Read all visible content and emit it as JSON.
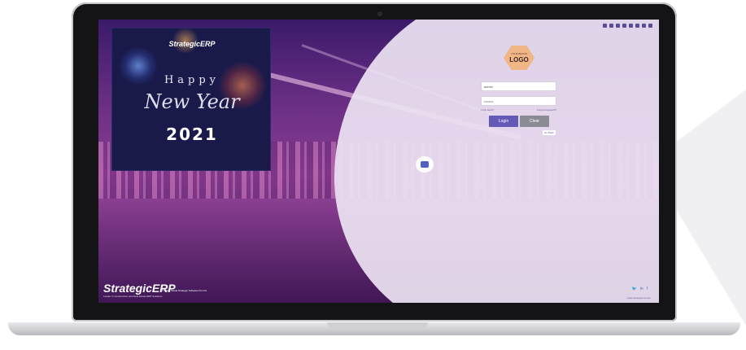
{
  "promo": {
    "brand": "StrategicERP",
    "happy": "Happy",
    "new_year": "New Year",
    "year": "2021"
  },
  "login": {
    "logo_small": "YOUR BRAND",
    "logo_text": "LOGO",
    "username_value": "admin",
    "password_value": "••••••••",
    "link_left": "Login Here?",
    "link_right": "Forgot password?",
    "login_label": "Login",
    "clear_label": "Clear",
    "small_link": "Go Back"
  },
  "footer": {
    "brand": "StrategicERP",
    "tagline": "Leader in Construction and Real Estate ERP Solutions",
    "copyright": "© 2021 Tiavak Strategic Software Pvt Ltd",
    "website": "www.strategicerp.com"
  },
  "icons": [
    "mail-icon",
    "facebook-icon",
    "user-icon",
    "globe-icon",
    "gear-icon",
    "calendar-icon",
    "chat-icon",
    "home-icon"
  ],
  "colors": {
    "login_button": "#6559b8",
    "clear_button": "#8b8b94",
    "logo_hex": "#f1b685",
    "promo_bg": "#1a1a4a"
  }
}
